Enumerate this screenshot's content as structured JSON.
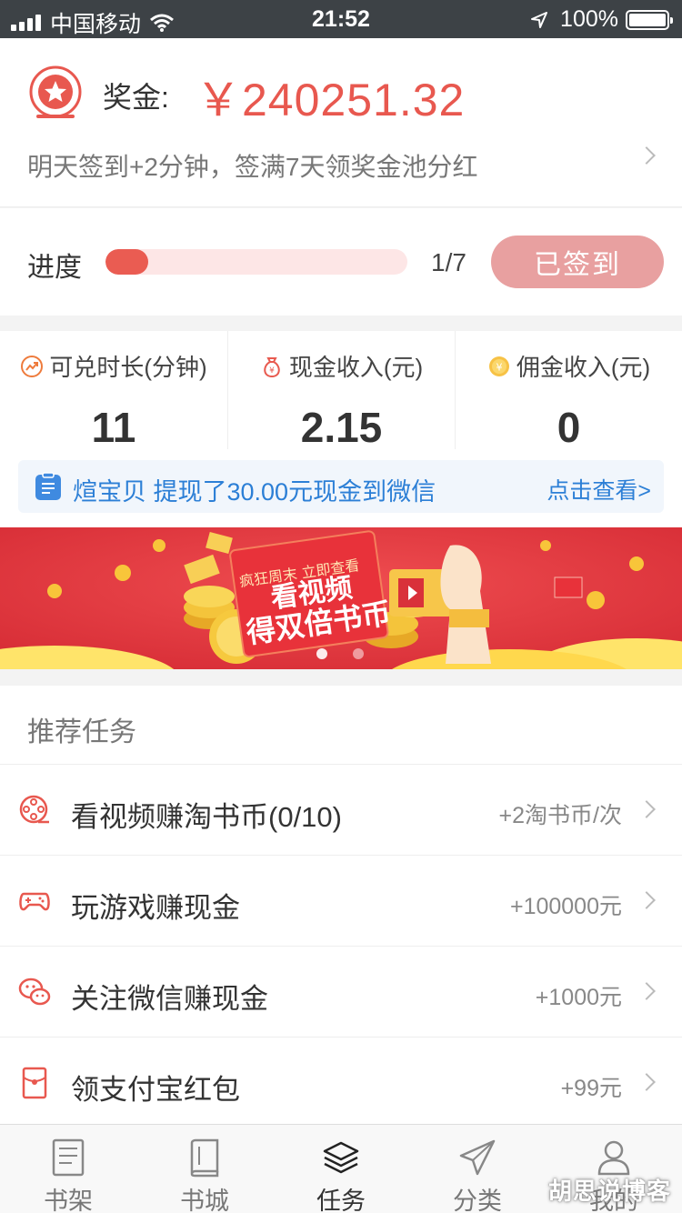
{
  "status_bar": {
    "carrier": "中国移动",
    "time": "21:52",
    "battery": "100%"
  },
  "bonus": {
    "label": "奖金:",
    "amount": "￥240251.32",
    "description": "明天签到+2分钟，签满7天领奖金池分红"
  },
  "progress": {
    "label": "进度",
    "value": 0.142857,
    "text": "1/7",
    "button_label": "已签到"
  },
  "stats": [
    {
      "label": "可兑时长(分钟)",
      "value": "11",
      "icon": "trend-icon"
    },
    {
      "label": "现金收入(元)",
      "value": "2.15",
      "icon": "money-bag-icon"
    },
    {
      "label": "佣金收入(元)",
      "value": "0",
      "icon": "coin-icon"
    }
  ],
  "notice": {
    "text": "煊宝贝 提现了30.00元现金到微信",
    "link": "点击查看>"
  },
  "banner": {
    "small_text": "疯狂周末 立即查看",
    "line1": "看视频",
    "line2": "得双倍书币"
  },
  "tasks": {
    "title": "推荐任务",
    "items": [
      {
        "label": "看视频赚淘书币(0/10)",
        "reward": "+2淘书币/次",
        "icon": "film-reel-icon"
      },
      {
        "label": "玩游戏赚现金",
        "reward": "+100000元",
        "icon": "gamepad-icon"
      },
      {
        "label": "关注微信赚现金",
        "reward": "+1000元",
        "icon": "wechat-icon"
      },
      {
        "label": "领支付宝红包",
        "reward": "+99元",
        "icon": "red-envelope-icon"
      }
    ]
  },
  "tabs": [
    {
      "label": "书架",
      "icon": "bookshelf-icon",
      "active": false
    },
    {
      "label": "书城",
      "icon": "book-icon",
      "active": false
    },
    {
      "label": "任务",
      "icon": "layers-icon",
      "active": true
    },
    {
      "label": "分类",
      "icon": "paper-plane-icon",
      "active": false
    },
    {
      "label": "我的",
      "icon": "user-icon",
      "active": false
    }
  ],
  "watermark": "胡思说博客",
  "colors": {
    "accent": "#e8584f",
    "link": "#2c7fd6",
    "signed_button": "#e8a0a0"
  }
}
